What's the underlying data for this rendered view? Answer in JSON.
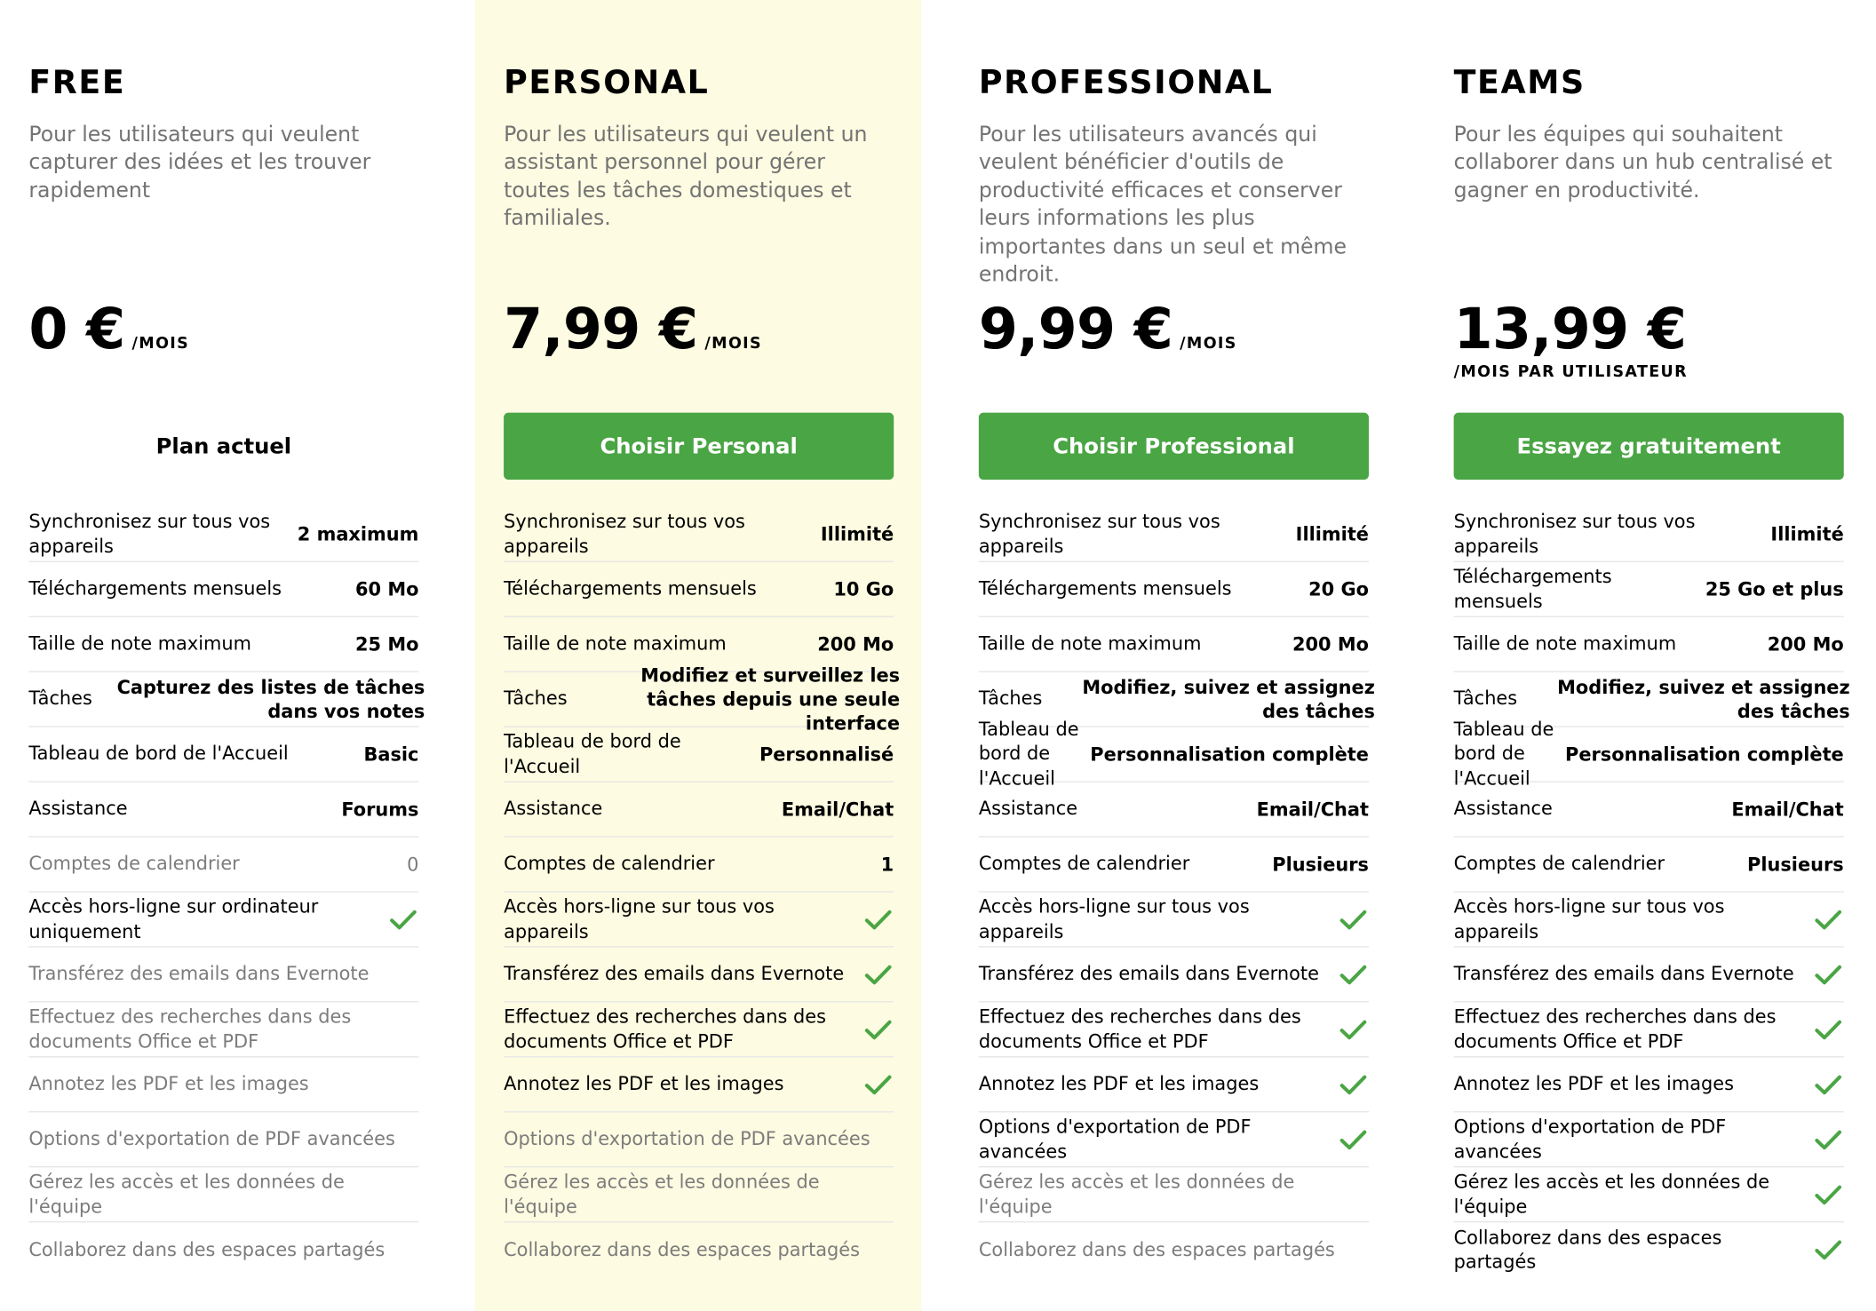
{
  "colors": {
    "accent_green": "#4aa544",
    "highlight_column": "#fdfbe1",
    "muted_text": "#737373"
  },
  "plans": [
    {
      "name": "FREE",
      "description": "Pour les utilisateurs qui veulent capturer des idées et les trouver rapidement",
      "price": "0 €",
      "period": "/MOIS",
      "action": "Plan actuel",
      "features": [
        {
          "label": "Synchronisez sur tous vos appareils",
          "value": "2 maximum"
        },
        {
          "label": "Téléchargements mensuels",
          "value": "60 Mo"
        },
        {
          "label": "Taille de note maximum",
          "value": "25 Mo"
        },
        {
          "label": "Tâches",
          "value": "Capturez des listes de tâches dans vos notes"
        },
        {
          "label": "Tableau de bord de l'Accueil",
          "value": "Basic"
        },
        {
          "label": "Assistance",
          "value": "Forums"
        },
        {
          "label": "Comptes de calendrier",
          "value": "0"
        },
        {
          "label": "Accès hors-ligne sur ordinateur uniquement",
          "icon": "check-icon"
        },
        {
          "label": "Transférez des emails dans Evernote"
        },
        {
          "label": "Effectuez des recherches dans des documents Office et PDF"
        },
        {
          "label": "Annotez les PDF et les images"
        },
        {
          "label": "Options d'exportation de PDF avancées"
        },
        {
          "label": "Gérez les accès et les données de l'équipe"
        },
        {
          "label": "Collaborez dans des espaces partagés"
        }
      ]
    },
    {
      "name": "PERSONAL",
      "description": "Pour les utilisateurs qui veulent un assistant personnel pour gérer toutes les tâches domestiques et familiales.",
      "price": "7,99 €",
      "period": "/MOIS",
      "action": "Choisir Personal",
      "features": [
        {
          "label": "Synchronisez sur tous vos appareils",
          "value": "Illimité"
        },
        {
          "label": "Téléchargements mensuels",
          "value": "10 Go"
        },
        {
          "label": "Taille de note maximum",
          "value": "200 Mo"
        },
        {
          "label": "Tâches",
          "value": "Modifiez et surveillez les tâches depuis une seule interface"
        },
        {
          "label": "Tableau de bord de l'Accueil",
          "value": "Personnalisé"
        },
        {
          "label": "Assistance",
          "value": "Email/Chat"
        },
        {
          "label": "Comptes de calendrier",
          "value": "1"
        },
        {
          "label": "Accès hors-ligne sur tous vos appareils",
          "icon": "check-icon"
        },
        {
          "label": "Transférez des emails dans Evernote",
          "icon": "check-icon"
        },
        {
          "label": "Effectuez des recherches dans des documents Office et PDF",
          "icon": "check-icon"
        },
        {
          "label": "Annotez les PDF et les images",
          "icon": "check-icon"
        },
        {
          "label": "Options d'exportation de PDF avancées"
        },
        {
          "label": "Gérez les accès et les données de l'équipe"
        },
        {
          "label": "Collaborez dans des espaces partagés"
        }
      ]
    },
    {
      "name": "PROFESSIONAL",
      "description": "Pour les utilisateurs avancés qui veulent bénéficier d'outils de productivité efficaces et conserver leurs informations les plus importantes dans un seul et même endroit.",
      "price": "9,99 €",
      "period": "/MOIS",
      "action": "Choisir Professional",
      "features": [
        {
          "label": "Synchronisez sur tous vos appareils",
          "value": "Illimité"
        },
        {
          "label": "Téléchargements mensuels",
          "value": "20 Go"
        },
        {
          "label": "Taille de note maximum",
          "value": "200 Mo"
        },
        {
          "label": "Tâches",
          "value": "Modifiez, suivez et assignez des tâches"
        },
        {
          "label": "Tableau de bord de l'Accueil",
          "value": "Personnalisation complète"
        },
        {
          "label": "Assistance",
          "value": "Email/Chat"
        },
        {
          "label": "Comptes de calendrier",
          "value": "Plusieurs"
        },
        {
          "label": "Accès hors-ligne sur tous vos appareils",
          "icon": "check-icon"
        },
        {
          "label": "Transférez des emails dans Evernote",
          "icon": "check-icon"
        },
        {
          "label": "Effectuez des recherches dans des documents Office et PDF",
          "icon": "check-icon"
        },
        {
          "label": "Annotez les PDF et les images",
          "icon": "check-icon"
        },
        {
          "label": "Options d'exportation de PDF avancées",
          "icon": "check-icon"
        },
        {
          "label": "Gérez les accès et les données de l'équipe"
        },
        {
          "label": "Collaborez dans des espaces partagés"
        }
      ]
    },
    {
      "name": "TEAMS",
      "description": "Pour les équipes qui souhaitent collaborer dans un hub centralisé et gagner en productivité.",
      "price": "13,99 €",
      "period": "/MOIS PAR UTILISATEUR",
      "action": "Essayez gratuitement",
      "features": [
        {
          "label": "Synchronisez sur tous vos appareils",
          "value": "Illimité"
        },
        {
          "label": "Téléchargements mensuels",
          "value": "25 Go et plus"
        },
        {
          "label": "Taille de note maximum",
          "value": "200 Mo"
        },
        {
          "label": "Tâches",
          "value": "Modifiez, suivez et assignez des tâches"
        },
        {
          "label": "Tableau de bord de l'Accueil",
          "value": "Personnalisation complète"
        },
        {
          "label": "Assistance",
          "value": "Email/Chat"
        },
        {
          "label": "Comptes de calendrier",
          "value": "Plusieurs"
        },
        {
          "label": "Accès hors-ligne sur tous vos appareils",
          "icon": "check-icon"
        },
        {
          "label": "Transférez des emails dans Evernote",
          "icon": "check-icon"
        },
        {
          "label": "Effectuez des recherches dans des documents Office et PDF",
          "icon": "check-icon"
        },
        {
          "label": "Annotez les PDF et les images",
          "icon": "check-icon"
        },
        {
          "label": "Options d'exportation de PDF avancées",
          "icon": "check-icon"
        },
        {
          "label": "Gérez les accès et les données de l'équipe",
          "icon": "check-icon"
        },
        {
          "label": "Collaborez dans des espaces partagés",
          "icon": "check-icon"
        }
      ]
    }
  ]
}
